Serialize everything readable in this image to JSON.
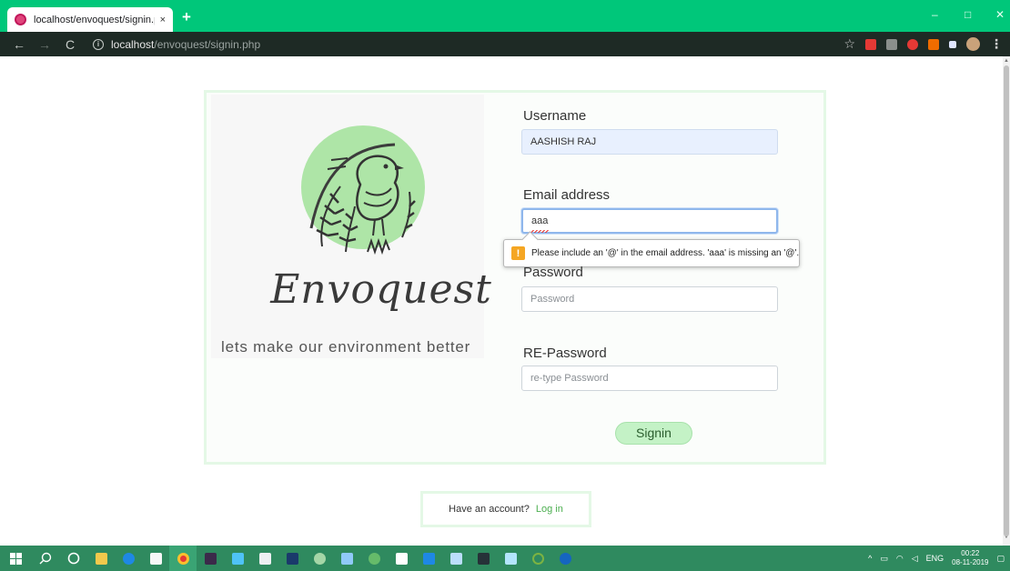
{
  "browser": {
    "tab_title": "localhost/envoquest/signin.php",
    "tab_close": "×",
    "new_tab": "+",
    "minimize": "–",
    "maximize": "□",
    "close": "✕",
    "back": "←",
    "forward": "→",
    "reload": "C",
    "url_host": "localhost",
    "url_path": "/envoquest/signin.php",
    "info": "i",
    "star": "☆",
    "menu": "⋮"
  },
  "brand": {
    "name": "Envoquest",
    "tagline": "lets make our environment better"
  },
  "form": {
    "username_label": "Username",
    "username_value": "AASHISH RAJ",
    "email_label": "Email address",
    "email_value": "aaa",
    "validation_message": "Please include an '@' in the email address. 'aaa' is missing an '@'.",
    "warning_symbol": "!",
    "password_label": "Password",
    "password_placeholder": "Password",
    "repassword_label": "RE-Password",
    "repassword_placeholder": "re-type Password",
    "signin_label": "Signin"
  },
  "login": {
    "prompt": "Have an account?",
    "link": "Log in"
  },
  "taskbar": {
    "language": "ENG",
    "time": "00:22",
    "date": "08-11-2019",
    "tray_chevron": "^"
  },
  "colors": {
    "tab_strip": "#00c77a",
    "accent_green": "#c4f2c6",
    "link_green": "#4caf50",
    "taskbar": "#2f8a5f"
  }
}
